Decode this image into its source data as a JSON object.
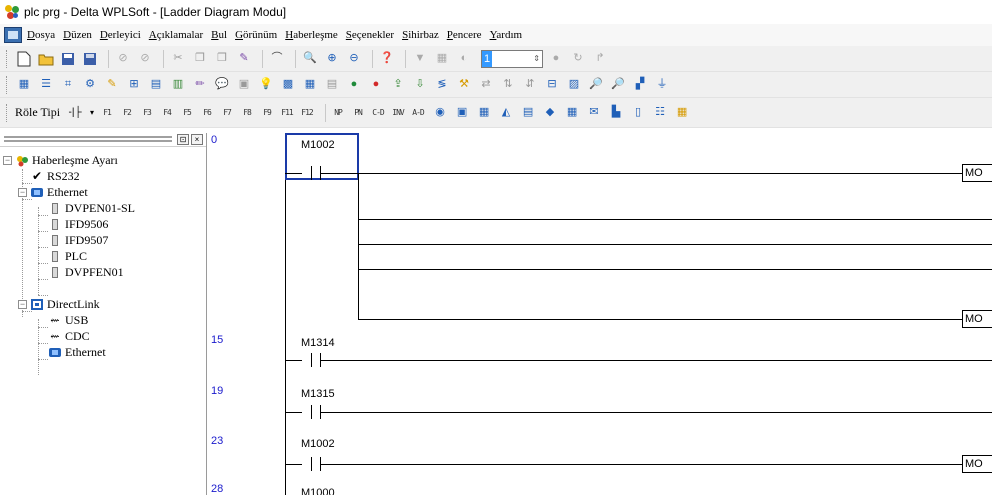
{
  "window": {
    "title": "plc prg - Delta WPLSoft - [Ladder Diagram Modu]"
  },
  "menu": {
    "items": [
      "Dosya",
      "Düzen",
      "Derleyici",
      "Açıklamalar",
      "Bul",
      "Görünüm",
      "Haberleşme",
      "Seçenekler",
      "Sihirbaz",
      "Pencere",
      "Yardım"
    ]
  },
  "toolbar1": {
    "step_value": "1"
  },
  "toolbar3": {
    "relay_label": "Röle Tipi",
    "fkeys": [
      "F1",
      "F2",
      "F3",
      "F4",
      "F5",
      "F6",
      "F7",
      "F8",
      "F9",
      "F11",
      "F12",
      "NP",
      "PN",
      "C-D",
      "INV",
      "A-D"
    ]
  },
  "tree": {
    "root": "Haberleşme Ayarı",
    "rs232": "RS232",
    "ethernet": "Ethernet",
    "ethernet_children": [
      "DVPEN01-SL",
      "IFD9506",
      "IFD9507",
      "PLC",
      "DVPFEN01"
    ],
    "directlink": "DirectLink",
    "directlink_children": [
      "USB",
      "CDC",
      "Ethernet"
    ]
  },
  "ladder": {
    "rungs": [
      {
        "step": "0",
        "contact": "M1002",
        "output": "MO"
      },
      {
        "step": "15",
        "contact": "M1314",
        "output": ""
      },
      {
        "step": "19",
        "contact": "M1315",
        "output": ""
      },
      {
        "step": "23",
        "contact": "M1002",
        "output": "MO"
      },
      {
        "step": "28",
        "contact": "M1000",
        "output": ""
      }
    ],
    "extra_output": "MO"
  },
  "colors": {
    "step_number": "#1a1acc",
    "selection": "#1a3aa8"
  }
}
